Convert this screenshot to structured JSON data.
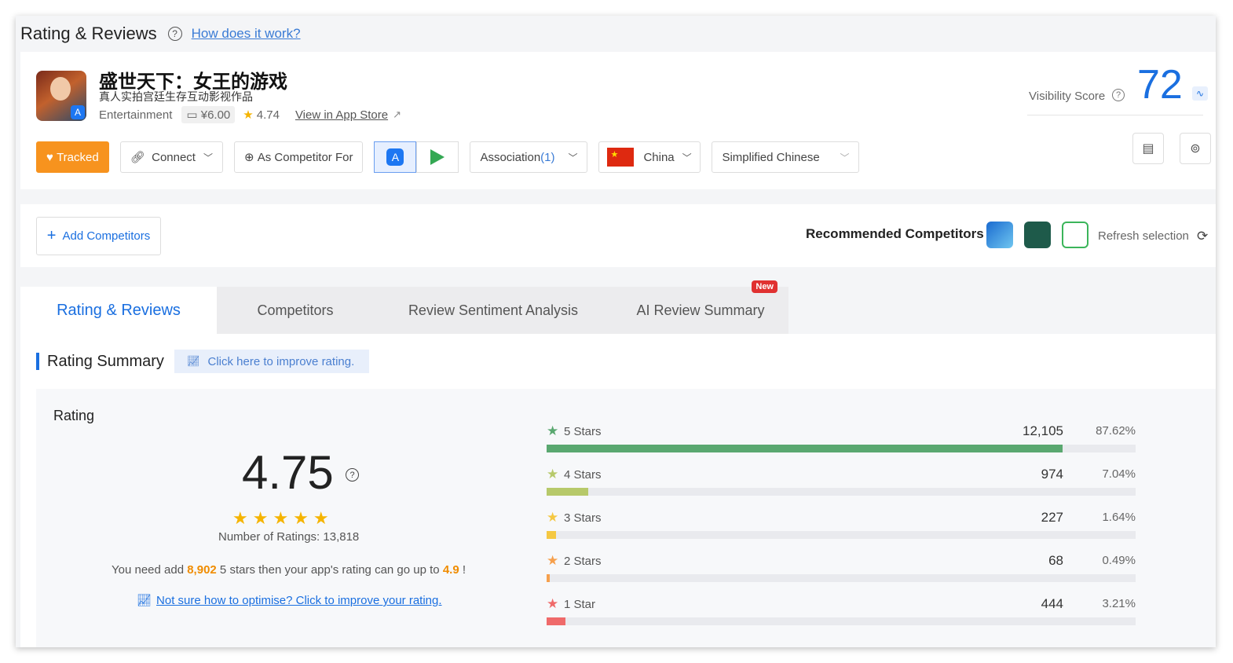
{
  "header": {
    "title": "Rating & Reviews",
    "help_icon": "question-circle-icon",
    "how_link": "How does it work?"
  },
  "app": {
    "name": "盛世天下：女王的游戏",
    "subtitle": "真人实拍宫廷生存互动影视作品",
    "category": "Entertainment",
    "price": "¥6.00",
    "rating": "4.74",
    "store_link": "View in App Store"
  },
  "visibility": {
    "label": "Visibility Score",
    "score": "72"
  },
  "toolbar": {
    "tracked": "Tracked",
    "connect": "Connect",
    "as_competitor": "As Competitor For",
    "association": "Association",
    "association_count": "(1)",
    "country": "China",
    "language": "Simplified Chinese"
  },
  "competitors": {
    "add_label": "Add Competitors",
    "recommended_label": "Recommended Competitors",
    "refresh_label": "Refresh selection"
  },
  "tabs": [
    {
      "label": "Rating & Reviews"
    },
    {
      "label": "Competitors"
    },
    {
      "label": "Review Sentiment Analysis"
    },
    {
      "label": "AI Review Summary",
      "badge": "New"
    }
  ],
  "summary": {
    "title": "Rating Summary",
    "improve_button": "Click here to improve rating.",
    "rating_label": "Rating",
    "score": "4.75",
    "num_ratings": "Number of Ratings: 13,818",
    "need_prefix": "You need add ",
    "need_count": "8,902",
    "need_middle": " 5 stars then your app's rating can go up to ",
    "need_target": "4.9",
    "need_suffix": " !",
    "optimise_link": "Not sure how to optimise? Click to improve your rating."
  },
  "distribution": [
    {
      "label": "5 Stars",
      "count": "12,105",
      "percent": "87.62%",
      "fraction": 0.8762,
      "color": "#5aa870"
    },
    {
      "label": "4 Stars",
      "count": "974",
      "percent": "7.04%",
      "fraction": 0.0704,
      "color": "#b7c96a"
    },
    {
      "label": "3 Stars",
      "count": "227",
      "percent": "1.64%",
      "fraction": 0.0164,
      "color": "#f5c842"
    },
    {
      "label": "2 Stars",
      "count": "68",
      "percent": "0.49%",
      "fraction": 0.0049,
      "color": "#f6a04d"
    },
    {
      "label": "1 Star",
      "count": "444",
      "percent": "3.21%",
      "fraction": 0.0321,
      "color": "#ef6a6a"
    }
  ]
}
